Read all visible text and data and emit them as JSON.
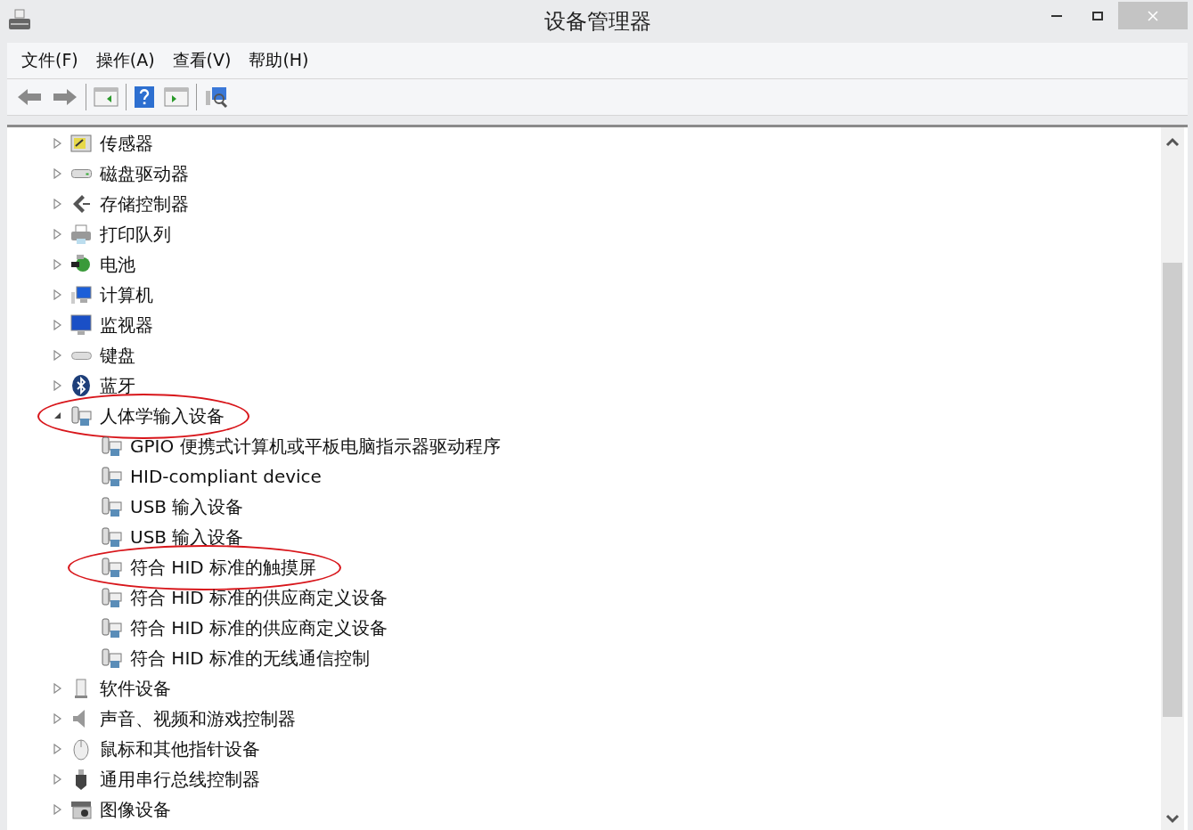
{
  "window": {
    "title": "设备管理器"
  },
  "menu": [
    "文件(F)",
    "操作(A)",
    "查看(V)",
    "帮助(H)"
  ],
  "tree": [
    {
      "label": "传感器",
      "expanded": false,
      "circled": false
    },
    {
      "label": "磁盘驱动器",
      "expanded": false,
      "circled": false
    },
    {
      "label": "存储控制器",
      "expanded": false,
      "circled": false
    },
    {
      "label": "打印队列",
      "expanded": false,
      "circled": false
    },
    {
      "label": "电池",
      "expanded": false,
      "circled": false
    },
    {
      "label": "计算机",
      "expanded": false,
      "circled": false
    },
    {
      "label": "监视器",
      "expanded": false,
      "circled": false
    },
    {
      "label": "键盘",
      "expanded": false,
      "circled": false
    },
    {
      "label": "蓝牙",
      "expanded": false,
      "circled": false
    },
    {
      "label": "人体学输入设备",
      "expanded": true,
      "circled": true,
      "children": [
        {
          "label": "GPIO 便携式计算机或平板电脑指示器驱动程序",
          "circled": false
        },
        {
          "label": "HID-compliant device",
          "circled": false
        },
        {
          "label": "USB 输入设备",
          "circled": false
        },
        {
          "label": "USB 输入设备",
          "circled": false
        },
        {
          "label": "符合 HID 标准的触摸屏",
          "circled": true
        },
        {
          "label": "符合 HID 标准的供应商定义设备",
          "circled": false
        },
        {
          "label": "符合 HID 标准的供应商定义设备",
          "circled": false
        },
        {
          "label": "符合 HID 标准的无线通信控制",
          "circled": false
        }
      ]
    },
    {
      "label": "软件设备",
      "expanded": false,
      "circled": false
    },
    {
      "label": "声音、视频和游戏控制器",
      "expanded": false,
      "circled": false
    },
    {
      "label": "鼠标和其他指针设备",
      "expanded": false,
      "circled": false
    },
    {
      "label": "通用串行总线控制器",
      "expanded": false,
      "circled": false
    },
    {
      "label": "图像设备",
      "expanded": false,
      "circled": false
    }
  ]
}
